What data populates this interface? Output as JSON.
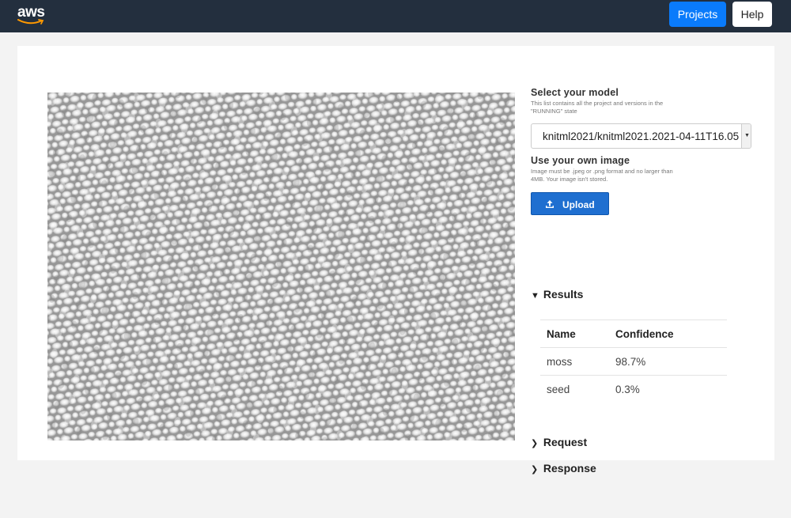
{
  "topbar": {
    "logo_text": "aws",
    "projects_label": "Projects",
    "help_label": "Help"
  },
  "model": {
    "heading": "Select your model",
    "description": "This list contains all the project and versions in the \"RUNNING\" state",
    "selected": "knitml2021/knitml2021.2021-04-11T16.05"
  },
  "own_image": {
    "heading": "Use your own image",
    "description": "Image must be .jpeg or .png format and no larger than 4MB. Your image isn't stored.",
    "upload_label": "Upload"
  },
  "results": {
    "heading": "Results",
    "columns": [
      "Name",
      "Confidence"
    ],
    "rows": [
      {
        "name": "moss",
        "confidence": "98.7%"
      },
      {
        "name": "seed",
        "confidence": "0.3%"
      }
    ]
  },
  "request": {
    "heading": "Request"
  },
  "response": {
    "heading": "Response"
  },
  "colors": {
    "topbar": "#232f3e",
    "projects_button": "#0a7bfb",
    "upload_button": "#1f6fd0"
  }
}
